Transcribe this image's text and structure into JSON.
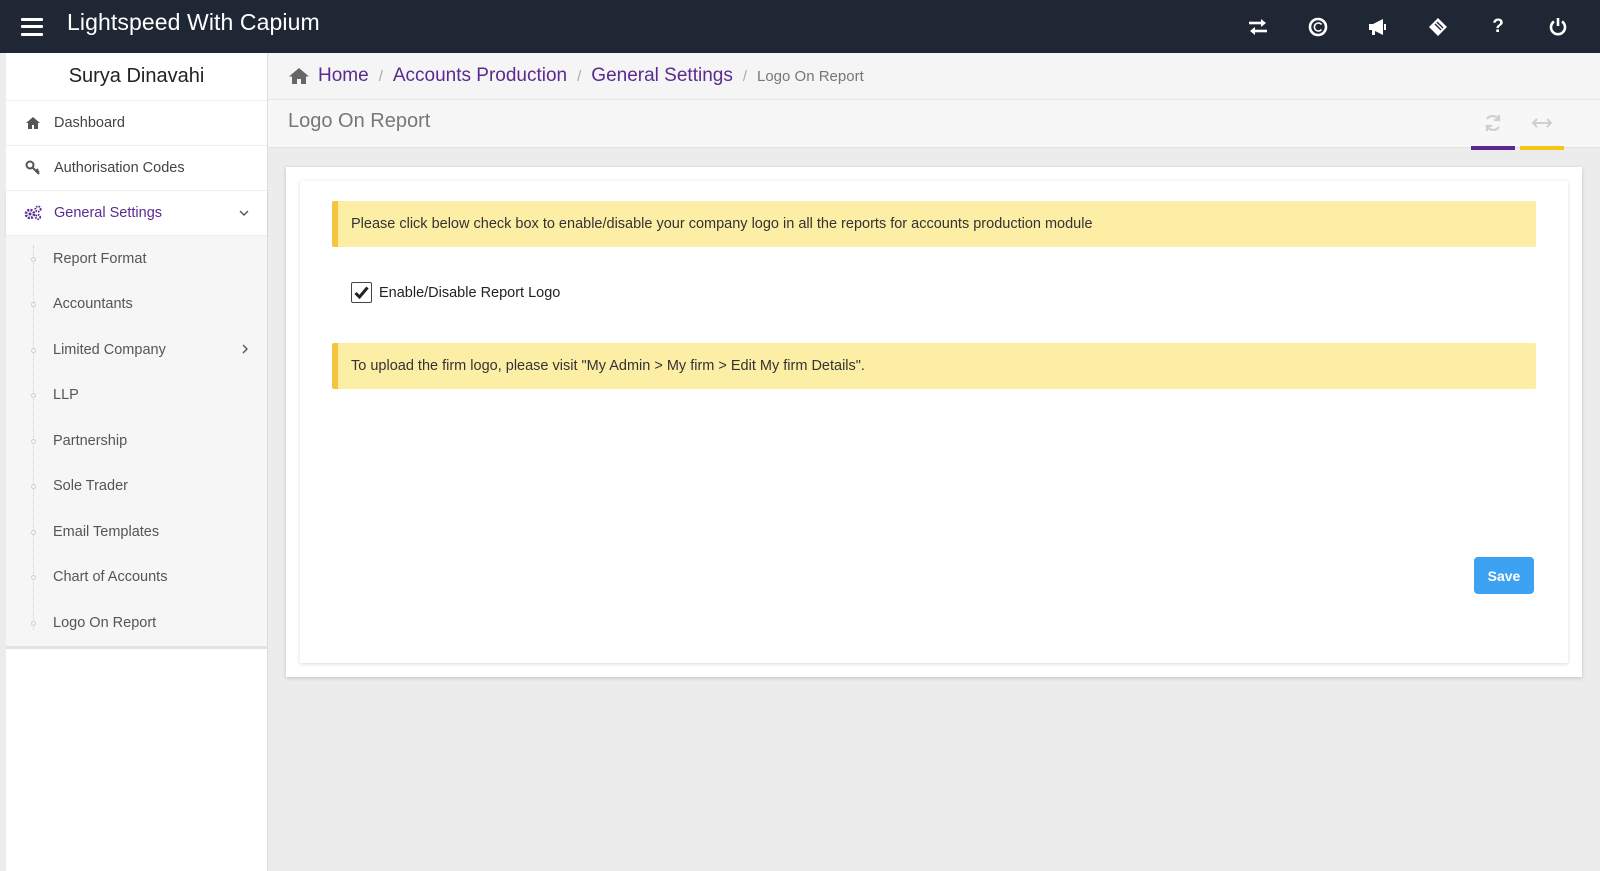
{
  "app": {
    "title": "Lightspeed With Capium",
    "top_icons": [
      "transfer-icon",
      "capium-icon",
      "megaphone-icon",
      "ticket-icon",
      "help-icon",
      "power-icon"
    ],
    "help_glyph": "?"
  },
  "sidebar": {
    "user_name": "Surya Dinavahi",
    "items": [
      {
        "label": "Dashboard",
        "icon": "home-icon"
      },
      {
        "label": "Authorisation Codes",
        "icon": "key-icon"
      },
      {
        "label": "General Settings",
        "icon": "gears-icon",
        "active": true
      }
    ],
    "sub_items": [
      {
        "label": "Report Format"
      },
      {
        "label": "Accountants"
      },
      {
        "label": "Limited Company",
        "has_children": true
      },
      {
        "label": "LLP"
      },
      {
        "label": "Partnership"
      },
      {
        "label": "Sole Trader"
      },
      {
        "label": "Email Templates"
      },
      {
        "label": "Chart of Accounts"
      },
      {
        "label": "Logo On Report"
      }
    ]
  },
  "breadcrumb": {
    "home": "Home",
    "level1": "Accounts Production",
    "level2": "General Settings",
    "current": "Logo On Report",
    "separator": "/"
  },
  "page": {
    "title": "Logo On Report"
  },
  "content": {
    "info_message": "Please click below check box to enable/disable your company logo in all the reports for accounts production module",
    "checkbox_label": "Enable/Disable Report Logo",
    "checkbox_checked": true,
    "upload_message": "To upload the firm logo, please visit \"My Admin > My firm > Edit My firm Details\".",
    "save_label": "Save"
  },
  "colors": {
    "topbar": "#1e2733",
    "accent_purple": "#5b2a8f",
    "accent_yellow": "#f5c518",
    "alert_bg": "#fdeea6",
    "save_button": "#3ea2f2"
  }
}
